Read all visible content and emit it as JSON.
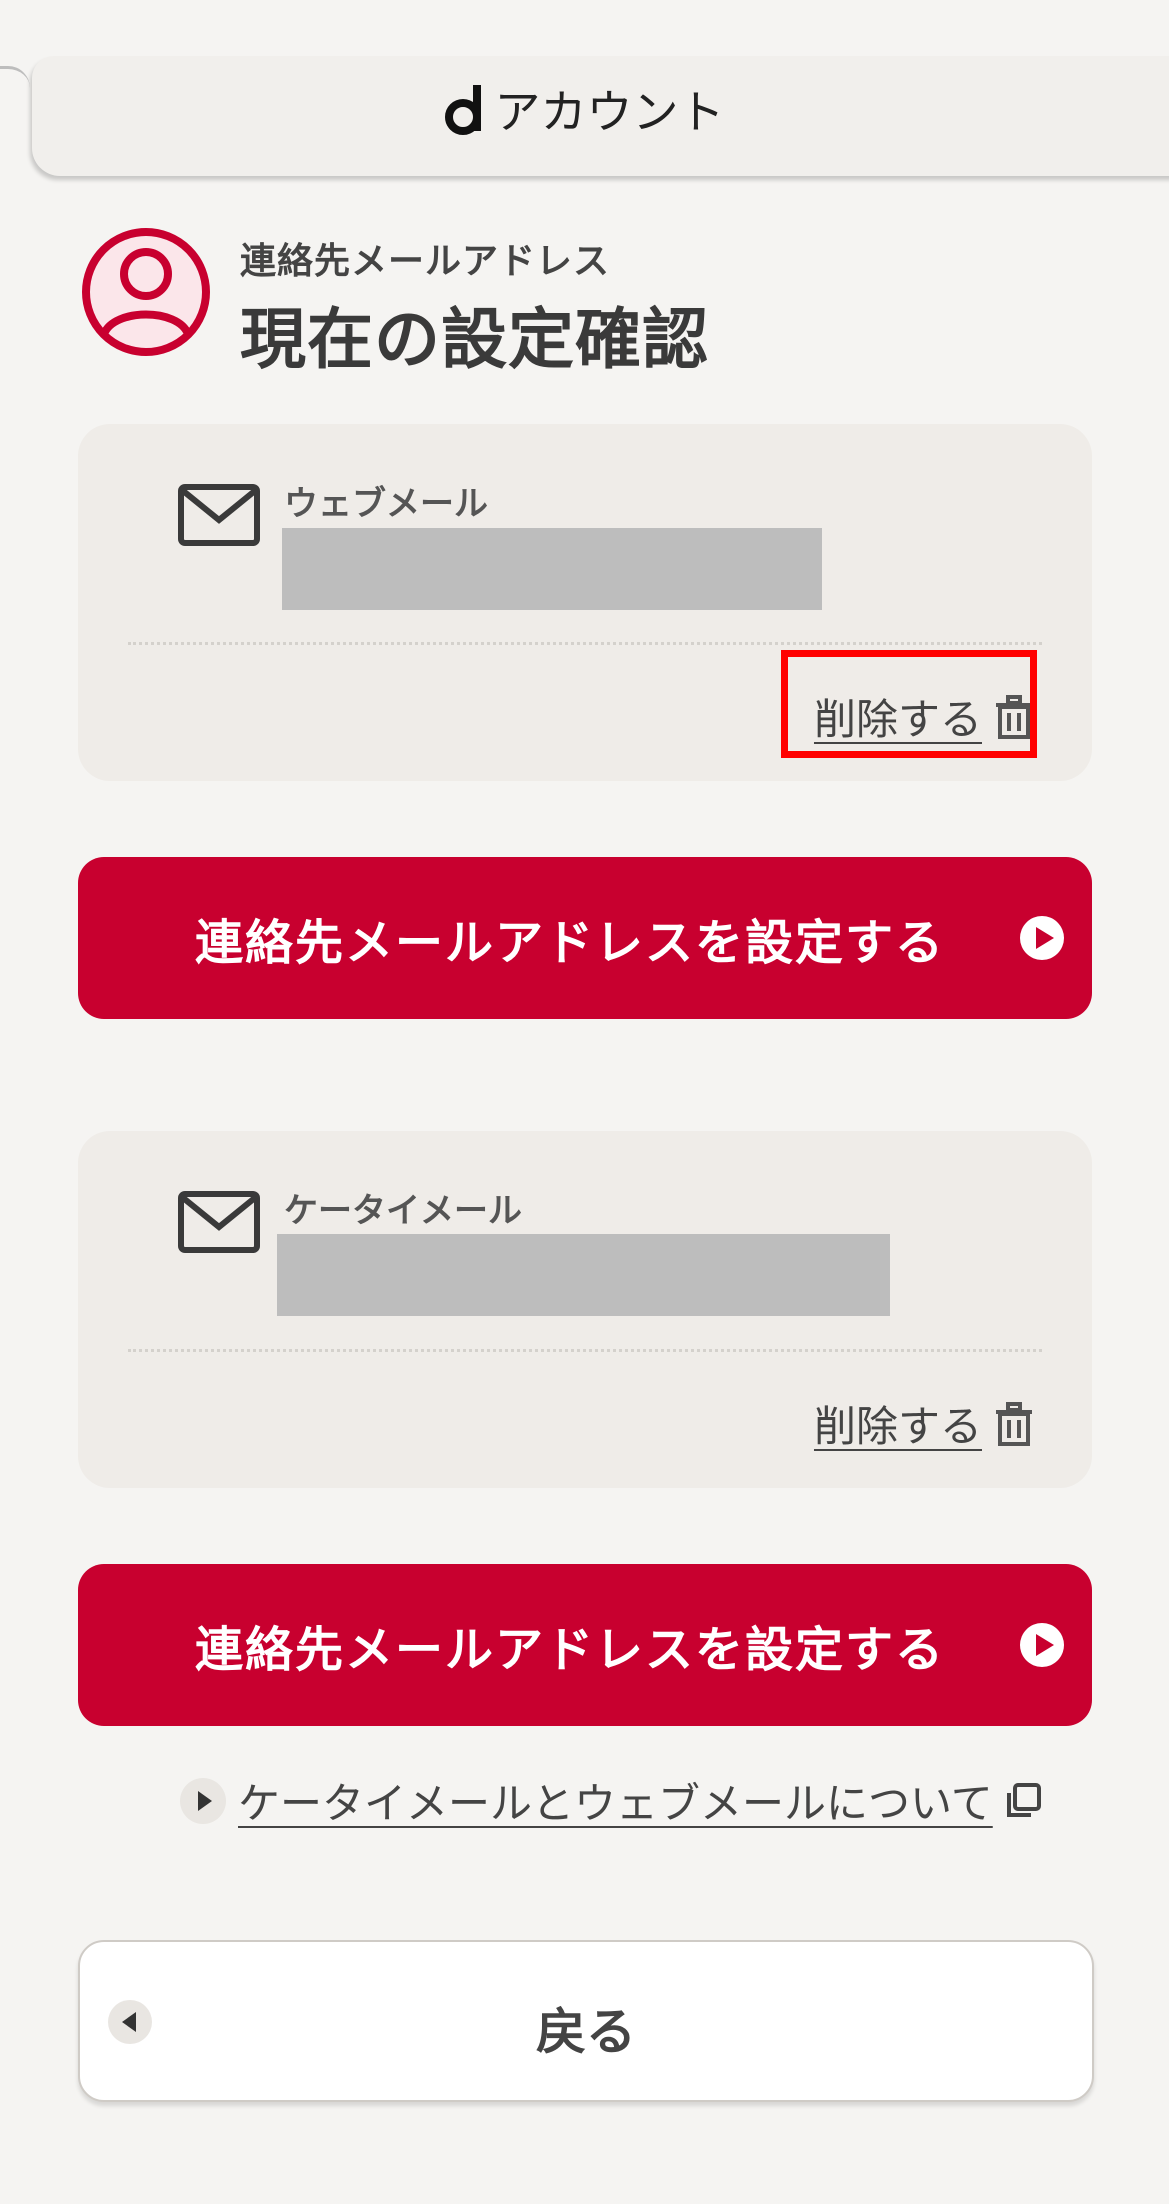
{
  "header": {
    "logo_letter": "d",
    "title": "アカウント"
  },
  "page": {
    "subtitle": "連絡先メールアドレス",
    "title": "現在の設定確認",
    "icon": "user-avatar-icon"
  },
  "cards": [
    {
      "label": "ウェブメール",
      "value": "",
      "delete_label": "削除する",
      "icons": {
        "mail": "mail-icon",
        "delete": "trash-icon"
      }
    },
    {
      "label": "ケータイメール",
      "value": "",
      "delete_label": "削除する",
      "icons": {
        "mail": "mail-icon",
        "delete": "trash-icon"
      }
    }
  ],
  "buttons": {
    "set_email_1": "連絡先メールアドレスを設定する",
    "set_email_2": "連絡先メールアドレスを設定する",
    "back": "戻る"
  },
  "links": {
    "about_mail": "ケータイメールとウェブメールについて"
  },
  "colors": {
    "accent": "#c8002f",
    "background": "#f5f4f2",
    "card": "#efece8",
    "highlight": "#ff0000"
  }
}
